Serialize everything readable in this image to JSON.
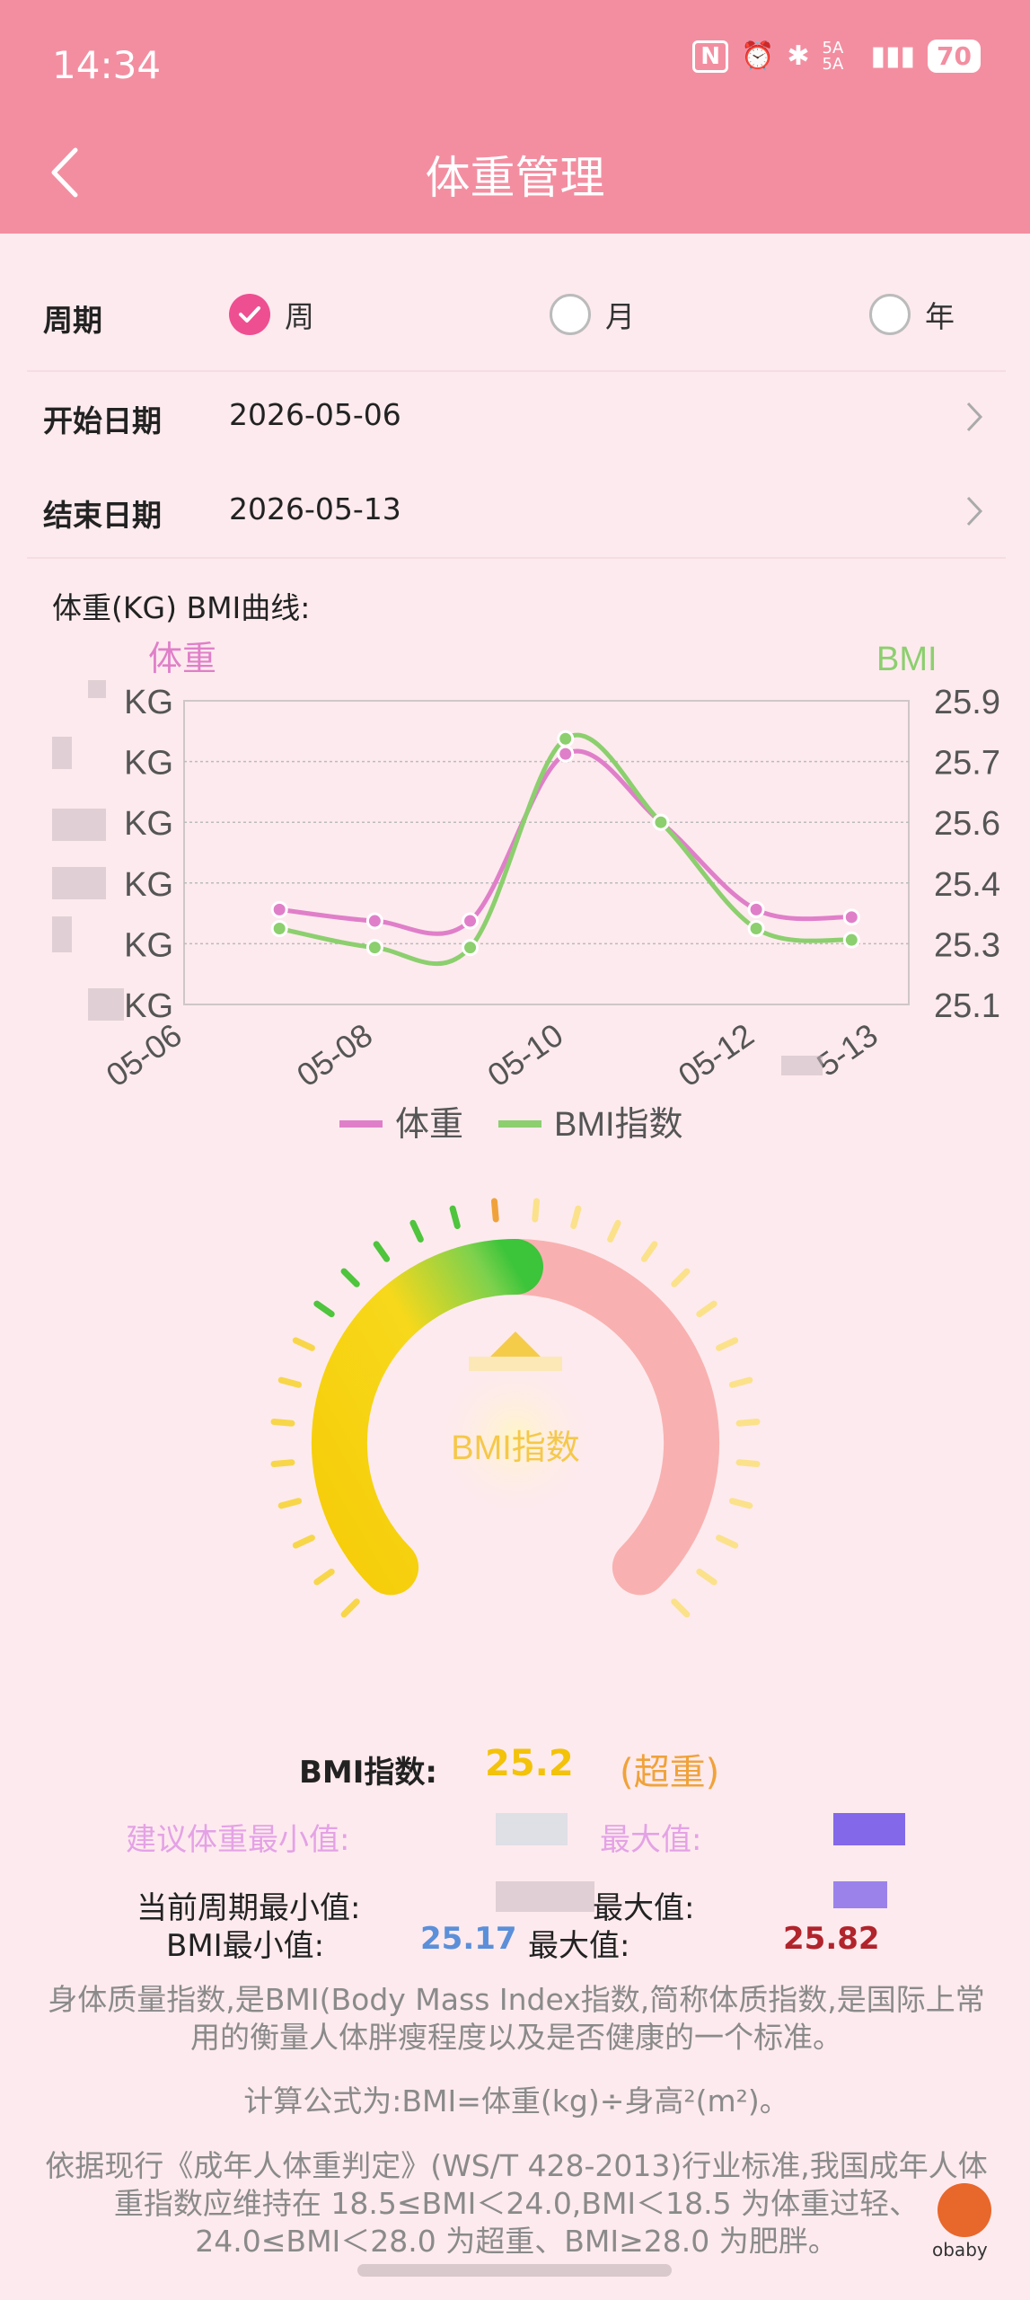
{
  "status_bar": {
    "time": "14:34",
    "network": "5A 5A",
    "battery": "70"
  },
  "header": {
    "title": "体重管理"
  },
  "period": {
    "label": "周期",
    "options": [
      {
        "label": "周",
        "selected": true
      },
      {
        "label": "月",
        "selected": false
      },
      {
        "label": "年",
        "selected": false
      }
    ]
  },
  "start_date": {
    "label": "开始日期",
    "value": "2026-05-06"
  },
  "end_date": {
    "label": "结束日期",
    "value": "2026-05-13"
  },
  "chart_title": "体重(KG) BMI曲线:",
  "chart_data": {
    "type": "line",
    "left_axis_title": "体重",
    "right_axis_title": "BMI",
    "left_ticks": [
      "KG",
      "KG",
      "KG",
      "KG",
      "KG",
      "KG"
    ],
    "right_ticks": [
      "25.9",
      "25.7",
      "25.6",
      "25.4",
      "25.3",
      "25.1"
    ],
    "x_ticks": [
      "05-06",
      "05-08",
      "05-10",
      "05-12",
      "5-13"
    ],
    "x": [
      "05-07",
      "05-08",
      "05-09",
      "05-10",
      "05-11",
      "05-12",
      "05-13"
    ],
    "series": [
      {
        "name": "体重",
        "color": "#e07fc9",
        "values": [
          25.35,
          25.32,
          25.32,
          25.76,
          25.58,
          25.35,
          25.33
        ]
      },
      {
        "name": "BMI指数",
        "color": "#8ccf6e",
        "values": [
          25.3,
          25.25,
          25.25,
          25.8,
          25.58,
          25.3,
          25.27
        ]
      }
    ],
    "ylim": [
      25.1,
      25.9
    ],
    "grid": true,
    "legend": "bottom"
  },
  "gauge": {
    "label": "BMI指数"
  },
  "stats": {
    "bmi_label": "BMI指数:",
    "bmi_value": "25.2",
    "bmi_status": "(超重)",
    "suggest_min_label": "建议体重最小值:",
    "suggest_max_label": "最大值:",
    "period_min_label": "当前周期最小值:",
    "period_max_label": "最大值:",
    "bmi_min_label": "BMI最小值:",
    "bmi_min_value": "25.17",
    "bmi_max_label": "最大值:",
    "bmi_max_value": "25.82"
  },
  "info": {
    "p1": "身体质量指数,是BMI(Body Mass Index指数,简称体质指数,是国际上常用的衡量人体胖瘦程度以及是否健康的一个标准。",
    "p2": "计算公式为:BMI=体重(kg)÷身高²(m²)。",
    "p3": "依据现行《成年人体重判定》(WS/T 428-2013)行业标准,我国成年人体重指数应维持在 18.5≤BMI＜24.0,BMI＜18.5 为体重过轻、24.0≤BMI＜28.0 为超重、BMI≥28.0 为肥胖。"
  },
  "watermark": "obaby"
}
